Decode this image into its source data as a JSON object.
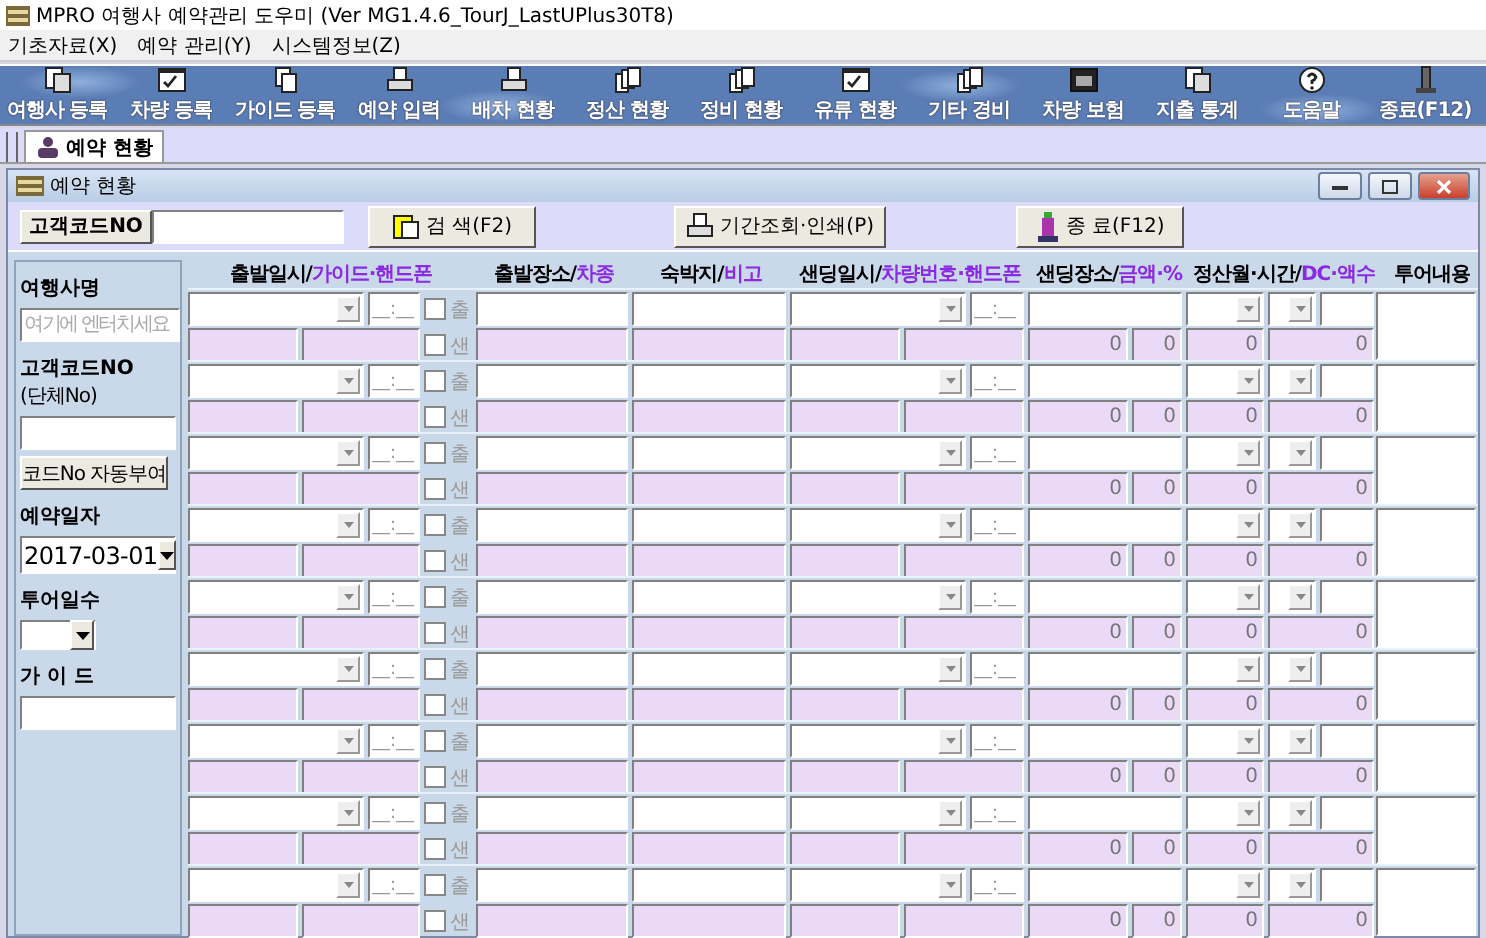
{
  "window": {
    "title": "MPRO 여행사 예약관리 도우미 (Ver MG1.4.6_TourJ_LastUPlus30T8)"
  },
  "menu": [
    "기초자료(X)",
    "예약 관리(Y)",
    "시스템정보(Z)"
  ],
  "toolbar": [
    {
      "label": "여행사 등록"
    },
    {
      "label": "차량 등록"
    },
    {
      "label": "가이드 등록"
    },
    {
      "label": "예약 입력"
    },
    {
      "label": "배차 현황"
    },
    {
      "label": "정산 현황"
    },
    {
      "label": "정비 현황"
    },
    {
      "label": "유류 현황"
    },
    {
      "label": "기타 경비"
    },
    {
      "label": "차량 보험"
    },
    {
      "label": "지출 통계"
    },
    {
      "label": "도움말"
    },
    {
      "label": "종료(F12)"
    }
  ],
  "tabs": [
    {
      "label": "예약 현황",
      "selected": true
    }
  ],
  "child_window": {
    "title": "예약 현황"
  },
  "search_bar": {
    "code_button": "고객코드NO",
    "search_button": "검 색(F2)",
    "print_button": "기간조회·인쇄(P)",
    "close_button": "종 료(F12)"
  },
  "side_panel": {
    "agency_label": "여행사명",
    "agency_placeholder": "여기에 엔터치세요",
    "code_label": "고객코드NO",
    "code_note": "(단체No)",
    "auto_code_button": "코드No 자동부여",
    "date_label": "예약일자",
    "date_value": "2017-03-01",
    "days_label": "투어일수",
    "guide_label": "가 이 드"
  },
  "columns": [
    {
      "main": "출발일시/",
      "sub": "가이드·핸드폰"
    },
    {
      "main": "출발장소/",
      "sub": "차종"
    },
    {
      "main": "숙박지/",
      "sub": "비고"
    },
    {
      "main": "샌딩일시/",
      "sub": "차량번호·핸드폰"
    },
    {
      "main": "샌딩장소/",
      "sub": "금액·%"
    },
    {
      "main": "정산월·시간/",
      "sub": "DC·액수"
    },
    {
      "main": "투어내용"
    }
  ],
  "records": [
    {
      "depart_time": {
        "placeholder": "__:__"
      },
      "departure": {
        "label": "출",
        "checked": false
      },
      "send_time": {
        "placeholder": "__:__"
      },
      "sending": {
        "label": "샌",
        "checked": false
      },
      "amount": "0",
      "percent": "0",
      "dc": "0",
      "dc_amount": "0"
    },
    {
      "depart_time": {
        "placeholder": "__:__"
      },
      "departure": {
        "label": "출",
        "checked": false
      },
      "send_time": {
        "placeholder": "__:__"
      },
      "sending": {
        "label": "샌",
        "checked": false
      },
      "amount": "0",
      "percent": "0",
      "dc": "0",
      "dc_amount": "0"
    },
    {
      "depart_time": {
        "placeholder": "__:__"
      },
      "departure": {
        "label": "출",
        "checked": false
      },
      "send_time": {
        "placeholder": "__:__"
      },
      "sending": {
        "label": "샌",
        "checked": false
      },
      "amount": "0",
      "percent": "0",
      "dc": "0",
      "dc_amount": "0"
    },
    {
      "depart_time": {
        "placeholder": "__:__"
      },
      "departure": {
        "label": "출",
        "checked": false
      },
      "send_time": {
        "placeholder": "__:__"
      },
      "sending": {
        "label": "샌",
        "checked": false
      },
      "amount": "0",
      "percent": "0",
      "dc": "0",
      "dc_amount": "0"
    },
    {
      "depart_time": {
        "placeholder": "__:__"
      },
      "departure": {
        "label": "출",
        "checked": false
      },
      "send_time": {
        "placeholder": "__:__"
      },
      "sending": {
        "label": "샌",
        "checked": false
      },
      "amount": "0",
      "percent": "0",
      "dc": "0",
      "dc_amount": "0"
    },
    {
      "depart_time": {
        "placeholder": "__:__"
      },
      "departure": {
        "label": "출",
        "checked": false
      },
      "send_time": {
        "placeholder": "__:__"
      },
      "sending": {
        "label": "샌",
        "checked": false
      },
      "amount": "0",
      "percent": "0",
      "dc": "0",
      "dc_amount": "0"
    },
    {
      "depart_time": {
        "placeholder": "__:__"
      },
      "departure": {
        "label": "출",
        "checked": false
      },
      "send_time": {
        "placeholder": "__:__"
      },
      "sending": {
        "label": "샌",
        "checked": false
      },
      "amount": "0",
      "percent": "0",
      "dc": "0",
      "dc_amount": "0"
    },
    {
      "depart_time": {
        "placeholder": "__:__"
      },
      "departure": {
        "label": "출",
        "checked": false
      },
      "send_time": {
        "placeholder": "__:__"
      },
      "sending": {
        "label": "샌",
        "checked": false
      },
      "amount": "0",
      "percent": "0",
      "dc": "0",
      "dc_amount": "0"
    },
    {
      "depart_time": {
        "placeholder": "__:__"
      },
      "departure": {
        "label": "출",
        "checked": false
      },
      "send_time": {
        "placeholder": "__:__"
      },
      "sending": {
        "label": "샌",
        "checked": false
      },
      "amount": "0",
      "percent": "0",
      "dc": "0",
      "dc_amount": "0"
    }
  ]
}
